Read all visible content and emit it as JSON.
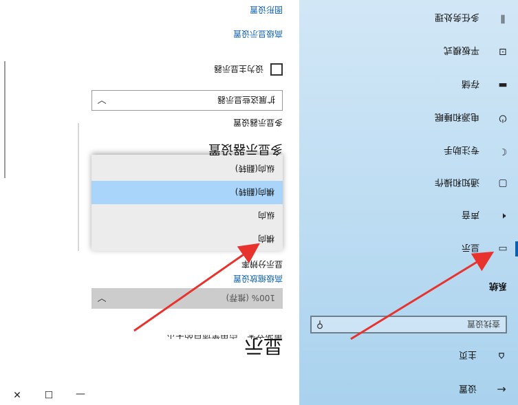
{
  "nav": {
    "back_label": "设置",
    "home_label": "主页",
    "search_placeholder": "查找设置",
    "section_title": "系统",
    "items": [
      {
        "label": "显示",
        "icon": "display-icon",
        "active": true
      },
      {
        "label": "声音",
        "icon": "speaker-icon",
        "active": false
      },
      {
        "label": "通知和操作",
        "icon": "notification-icon",
        "active": false
      },
      {
        "label": "专注助手",
        "icon": "moon-icon",
        "active": false
      },
      {
        "label": "电源和睡眠",
        "icon": "power-icon",
        "active": false
      },
      {
        "label": "存储",
        "icon": "storage-icon",
        "active": false
      },
      {
        "label": "平板模式",
        "icon": "tablet-icon",
        "active": false
      },
      {
        "label": "多任务处理",
        "icon": "multitask-icon",
        "active": false
      }
    ]
  },
  "content": {
    "title": "显示",
    "cutoff_text": "更改文本、应用等项目的大小",
    "scale_value": "100% (推荐)",
    "advanced_scaling_link": "高级缩放设置",
    "resolution_label": "显示分辨率",
    "orientation_options": [
      "横向",
      "纵向",
      "横向(翻转)",
      "纵向(翻转)"
    ],
    "orientation_selected_index": 2,
    "multi_display_heading": "多显示器设置",
    "multi_display_label": "多显示器设置",
    "multi_display_value": "扩展这些显示器",
    "main_display_checkbox": "设为主显示器",
    "advanced_display_link": "高级显示设置",
    "graphics_link": "图形设置"
  },
  "window": {
    "minimize": "—",
    "maximize": "☐",
    "close": "✕"
  },
  "colors": {
    "accent": "#0a5fb4",
    "arrow": "#e8322d",
    "selection": "#a9d5fb"
  }
}
